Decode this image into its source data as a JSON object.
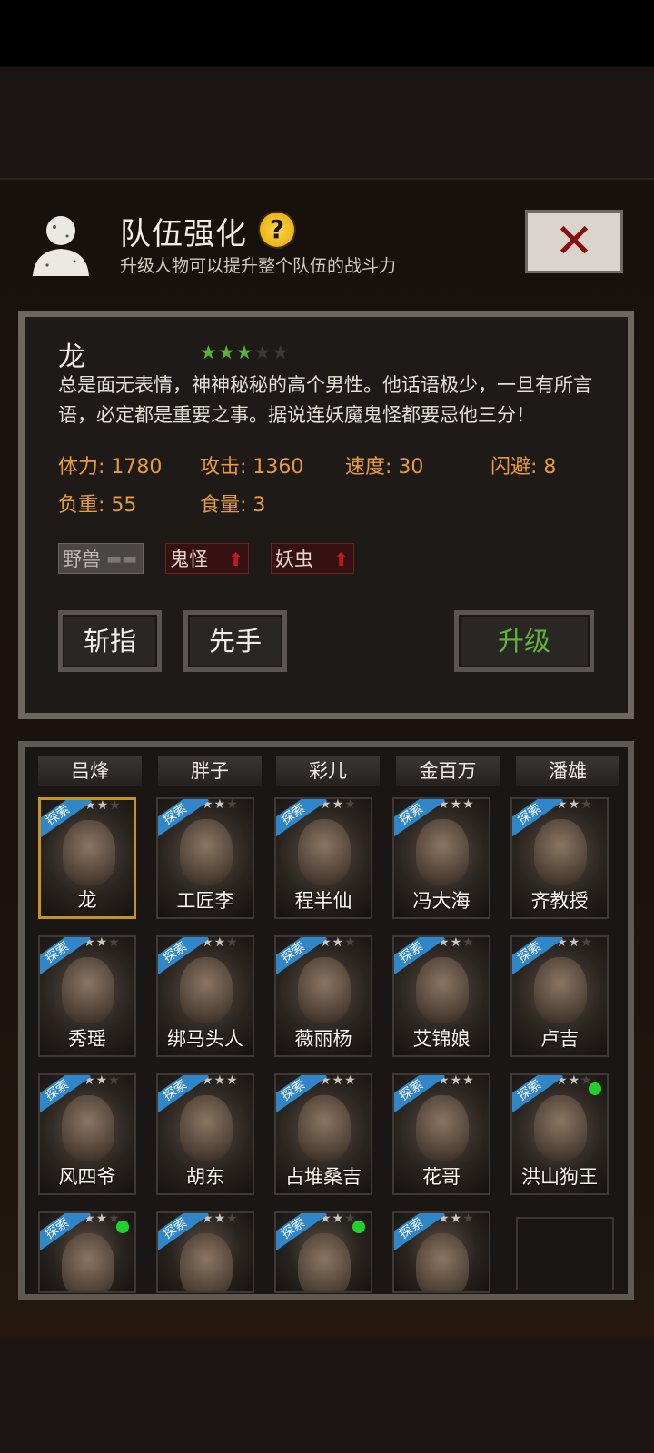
{
  "header": {
    "title": "队伍强化",
    "subtitle": "升级人物可以提升整个队伍的战斗力",
    "help_label": "?",
    "close_label": "✕"
  },
  "character": {
    "name": "龙",
    "stars_filled": 3,
    "stars_total": 5,
    "description": "总是面无表情，神神秘秘的高个男性。他话语极少，一旦有所言语，必定都是重要之事。据说连妖魔鬼怪都要忌他三分！",
    "stats": {
      "stamina": "体力: 1780",
      "attack": "攻击: 1360",
      "speed": "速度: 30",
      "dodge": "闪避: 8",
      "load": "负重: 55",
      "food": "食量: 3"
    },
    "tags": [
      {
        "label": "野兽",
        "indicator": "--"
      },
      {
        "label": "鬼怪",
        "indicator": "up"
      },
      {
        "label": "妖虫",
        "indicator": "up"
      }
    ]
  },
  "buttons": {
    "skill1": "斩指",
    "skill2": "先手",
    "upgrade": "升级"
  },
  "teams": [
    "吕烽",
    "胖子",
    "彩儿",
    "金百万",
    "潘雄"
  ],
  "explore_badge": "探索",
  "roster": [
    {
      "name": "龙",
      "stars": 2,
      "selected": true,
      "explore": true,
      "online": false
    },
    {
      "name": "工匠李",
      "stars": 2,
      "explore": true,
      "online": false
    },
    {
      "name": "程半仙",
      "stars": 2,
      "explore": true,
      "online": false
    },
    {
      "name": "冯大海",
      "stars": 3,
      "explore": true,
      "online": false
    },
    {
      "name": "齐教授",
      "stars": 2,
      "explore": true,
      "online": false
    },
    {
      "name": "秀瑶",
      "stars": 2,
      "explore": true,
      "online": false
    },
    {
      "name": "绑马头人",
      "stars": 2,
      "explore": true,
      "online": false
    },
    {
      "name": "薇丽杨",
      "stars": 2,
      "explore": true,
      "online": false
    },
    {
      "name": "艾锦娘",
      "stars": 2,
      "explore": true,
      "online": false
    },
    {
      "name": "卢吉",
      "stars": 2,
      "explore": true,
      "online": false
    },
    {
      "name": "风四爷",
      "stars": 2,
      "explore": true,
      "online": false
    },
    {
      "name": "胡东",
      "stars": 3,
      "explore": true,
      "online": false
    },
    {
      "name": "占堆桑吉",
      "stars": 3,
      "explore": true,
      "online": false
    },
    {
      "name": "花哥",
      "stars": 3,
      "explore": true,
      "online": false
    },
    {
      "name": "洪山狗王",
      "stars": 2,
      "explore": true,
      "online": true
    },
    {
      "name": "",
      "stars": 2,
      "explore": true,
      "online": true
    },
    {
      "name": "",
      "stars": 2,
      "explore": true,
      "online": false
    },
    {
      "name": "",
      "stars": 2,
      "explore": true,
      "online": true
    },
    {
      "name": "",
      "stars": 2,
      "explore": true,
      "online": false
    }
  ]
}
